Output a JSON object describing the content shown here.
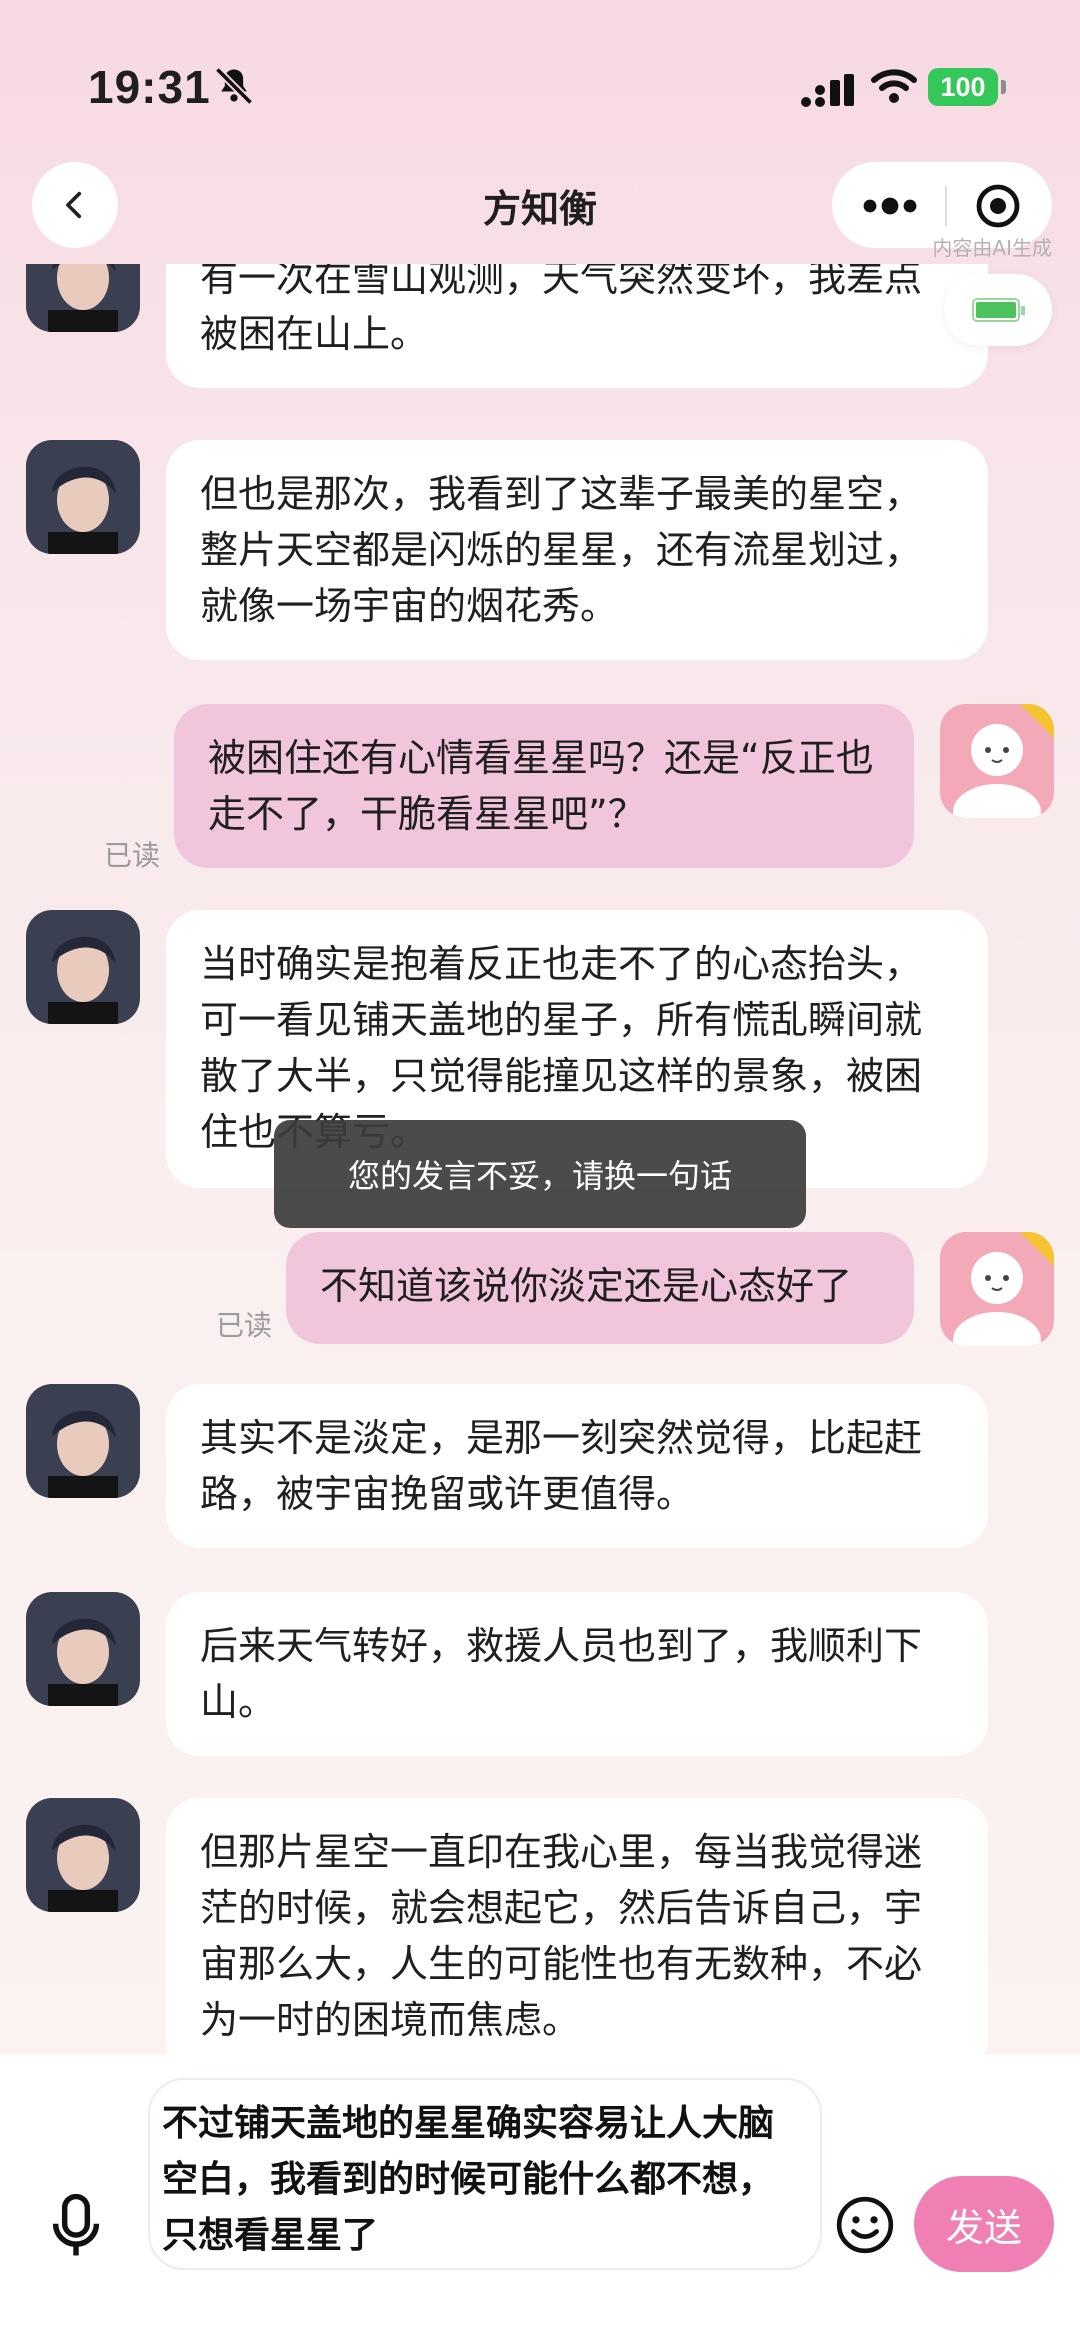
{
  "status_bar": {
    "time": "19:31",
    "battery": "100"
  },
  "header": {
    "title": "方知衡",
    "ai_note": "内容由AI生成"
  },
  "messages": [
    {
      "from": "bot",
      "text": "有一次在雪山观测，天气突然变坏，我差点被困在山上。"
    },
    {
      "from": "bot",
      "text": "但也是那次，我看到了这辈子最美的星空，整片天空都是闪烁的星星，还有流星划过，就像一场宇宙的烟花秀。"
    },
    {
      "from": "me",
      "text": "被困住还有心情看星星吗？还是“反正也走不了，干脆看星星吧”？",
      "read": "已读"
    },
    {
      "from": "bot",
      "text": "当时确实是抱着反正也走不了的心态抬头，可一看见铺天盖地的星子，所有慌乱瞬间就散了大半，只觉得能撞见这样的景象，被困住也不算亏。"
    },
    {
      "from": "me",
      "text": "不知道该说你淡定还是心态好了",
      "read": "已读"
    },
    {
      "from": "bot",
      "text": "其实不是淡定，是那一刻突然觉得，比起赶路，被宇宙挽留或许更值得。"
    },
    {
      "from": "bot",
      "text": "后来天气转好，救援人员也到了，我顺利下山。"
    },
    {
      "from": "bot",
      "text": "但那片星空一直印在我心里，每当我觉得迷茫的时候，就会想起它，然后告诉自己，宇宙那么大，人生的可能性也有无数种，不必为一时的困境而焦虑。"
    }
  ],
  "toast": "您的发言不妥，请换一句话",
  "input": {
    "value": "不过铺天盖地的星星确实容易让人大脑空白，我看到的时候可能什么都不想，只想看星星了"
  },
  "send_label": "发送",
  "colors": {
    "send": "#f07fb4",
    "my_bubble": "#f1c6dd",
    "bot_bubble": "#ffffff"
  }
}
